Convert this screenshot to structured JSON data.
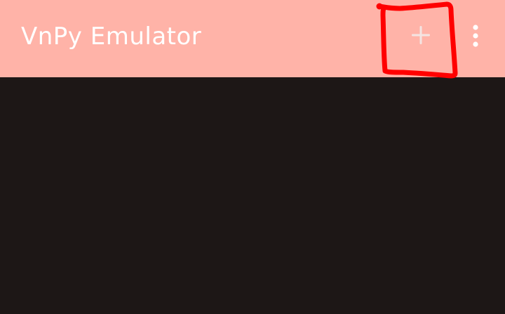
{
  "app": {
    "title": "VnPy Emulator"
  },
  "toolbar": {
    "add_icon": "plus-icon",
    "overflow_icon": "more-vertical-icon"
  },
  "annotation": {
    "shape": "hand-drawn-box",
    "target": "add-button"
  },
  "colors": {
    "toolbar": "#ffb3a8",
    "background": "#1d1716",
    "title_text": "#ffffff",
    "add_icon": "#f4e4e2",
    "annotation": "#ff0000"
  }
}
